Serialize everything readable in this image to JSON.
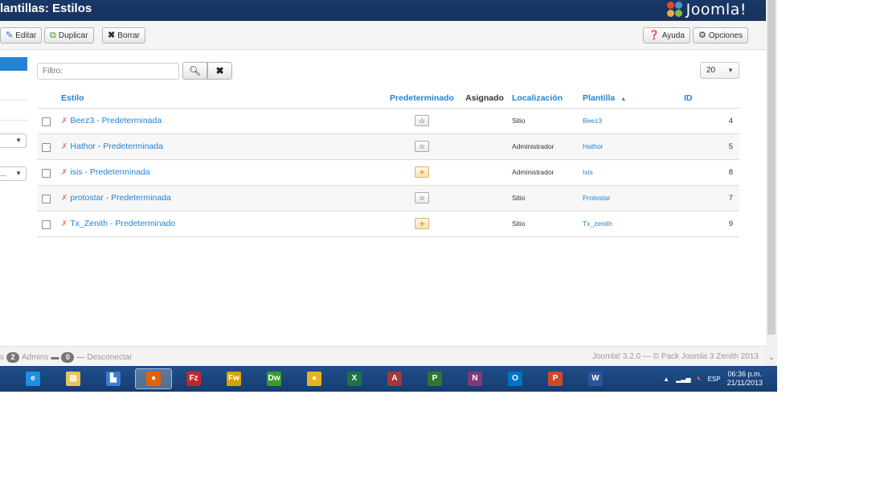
{
  "header": {
    "title": "lantillas: Estilos",
    "brand": "Joomla!"
  },
  "toolbar": {
    "edit_label": "Editar",
    "duplicate_label": "Duplicar",
    "delete_label": "Borrar",
    "help_label": "Ayuda",
    "options_label": "Opciones"
  },
  "filter": {
    "placeholder": "Filtro:",
    "limit_value": "20"
  },
  "table": {
    "headers": {
      "style": "Estilo",
      "default": "Predeterminado",
      "assigned": "Asignado",
      "location": "Localización",
      "template": "Plantilla",
      "sort_indicator": "▲",
      "id": "ID"
    },
    "rows": [
      {
        "name": "Beez3 - Predeterminada",
        "location": "Sitio",
        "template": "Beez3",
        "id": "4",
        "is_default": false
      },
      {
        "name": "Hathor - Predeterminada",
        "location": "Administrador",
        "template": "Hathor",
        "id": "5",
        "is_default": false
      },
      {
        "name": "isis - Predeterminada",
        "location": "Administrador",
        "template": "Isis",
        "id": "8",
        "is_default": true
      },
      {
        "name": "protostar - Predeterminada",
        "location": "Sitio",
        "template": "Protostar",
        "id": "7",
        "is_default": false
      },
      {
        "name": "Tx_Zenith - Predeterminado",
        "location": "Sitio",
        "template": "Tx_zenith",
        "id": "9",
        "is_default": true
      }
    ]
  },
  "status": {
    "left_prefix": "s",
    "admins_count": "2",
    "admins_label": "Admins",
    "messages_count": "0",
    "logout_label": "Desconectar",
    "footer": "Joomla! 3.2.0 — © Pack Joomla 3 Zenith 2013"
  },
  "taskbar": {
    "language": "ESP",
    "time": "06:36 p.m.",
    "date": "21/11/2013",
    "apps": [
      {
        "name": "ie",
        "glyph": "e",
        "color": "#1e8fe0"
      },
      {
        "name": "file-explorer",
        "glyph": "▤",
        "color": "#e8c25a"
      },
      {
        "name": "windows-explorer",
        "glyph": "▙",
        "color": "#3a7bd5"
      },
      {
        "name": "firefox",
        "glyph": "●",
        "color": "#e66000"
      },
      {
        "name": "filezilla",
        "glyph": "Fz",
        "color": "#c0272d"
      },
      {
        "name": "fireworks",
        "glyph": "Fw",
        "color": "#d7a300"
      },
      {
        "name": "dreamweaver",
        "glyph": "Dw",
        "color": "#3a9a2e"
      },
      {
        "name": "chrome",
        "glyph": "●",
        "color": "#e9b320"
      },
      {
        "name": "excel",
        "glyph": "X",
        "color": "#1e7145"
      },
      {
        "name": "access",
        "glyph": "A",
        "color": "#a4373a"
      },
      {
        "name": "project",
        "glyph": "P",
        "color": "#31752f"
      },
      {
        "name": "onenote",
        "glyph": "N",
        "color": "#80397b"
      },
      {
        "name": "outlook",
        "glyph": "O",
        "color": "#0072c6"
      },
      {
        "name": "powerpoint",
        "glyph": "P",
        "color": "#d24726"
      },
      {
        "name": "word",
        "glyph": "W",
        "color": "#2b579a"
      }
    ]
  }
}
